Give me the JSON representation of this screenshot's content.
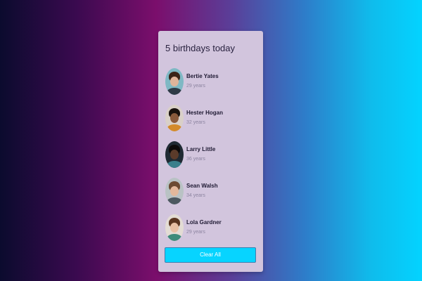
{
  "card": {
    "title": "5 birthdays today",
    "people": [
      {
        "name": "Bertie Yates",
        "age": "29 years",
        "avatar_icon": "person-avatar-icon"
      },
      {
        "name": "Hester Hogan",
        "age": "32 years",
        "avatar_icon": "person-avatar-icon"
      },
      {
        "name": "Larry Little",
        "age": "36 years",
        "avatar_icon": "person-avatar-icon"
      },
      {
        "name": "Sean Walsh",
        "age": "34 years",
        "avatar_icon": "person-avatar-icon"
      },
      {
        "name": "Lola Gardner",
        "age": "29 years",
        "avatar_icon": "person-avatar-icon"
      }
    ],
    "clear_button_label": "Clear All"
  },
  "colors": {
    "card_background": "#d2c5dd",
    "button_background": "#07d4ff",
    "gradient_left": "#0b0b2e",
    "gradient_middle": "#7b0e6c",
    "gradient_right": "#03d3ff"
  }
}
